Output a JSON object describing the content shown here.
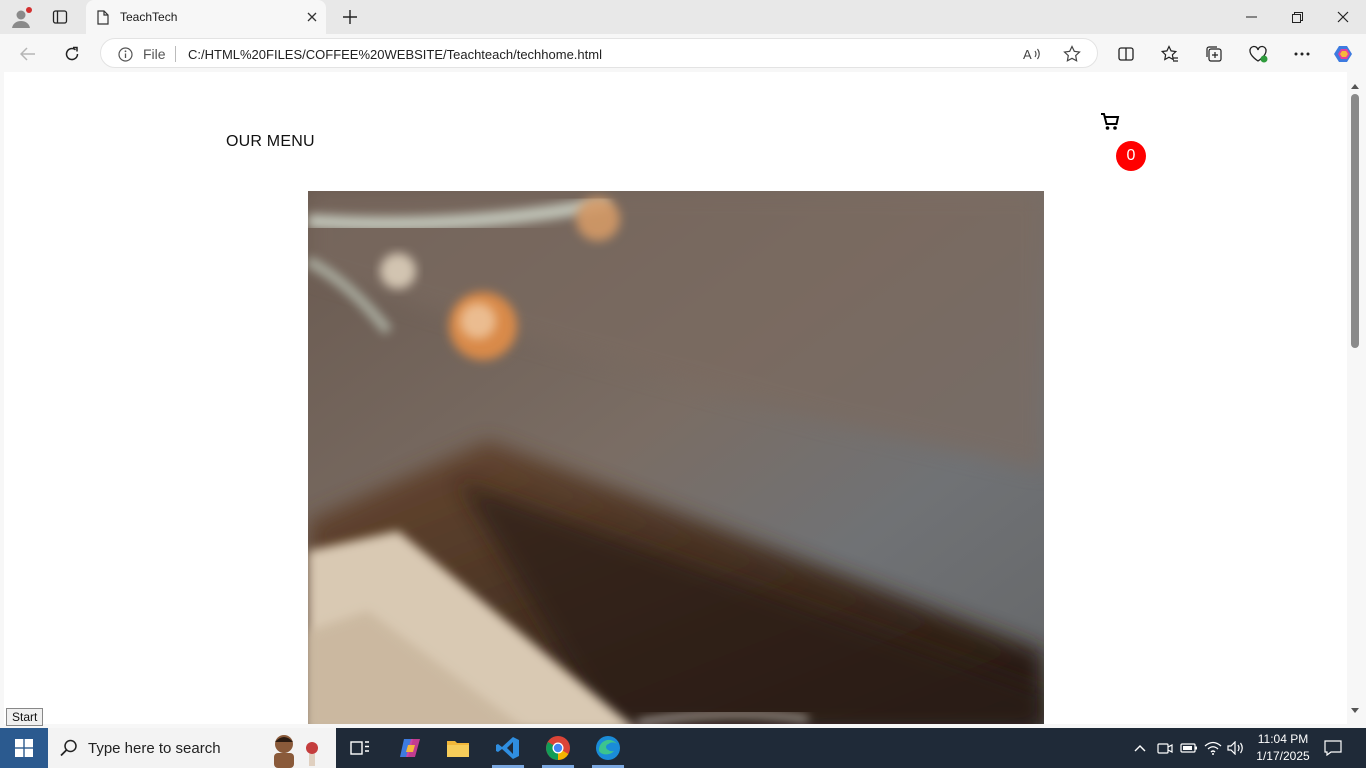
{
  "browser": {
    "tab_title": "TeachTech",
    "address_scheme": "File",
    "address_url": "C:/HTML%20FILES/COFFEE%20WEBSITE/Teachteach/techhome.html"
  },
  "page": {
    "menu_label": "OUR MENU",
    "cart_count": "0",
    "cart_badge_color": "#ff0000"
  },
  "tooltip": "Start",
  "taskbar": {
    "search_placeholder": "Type here to search",
    "time": "11:04 PM",
    "date": "1/17/2025"
  }
}
